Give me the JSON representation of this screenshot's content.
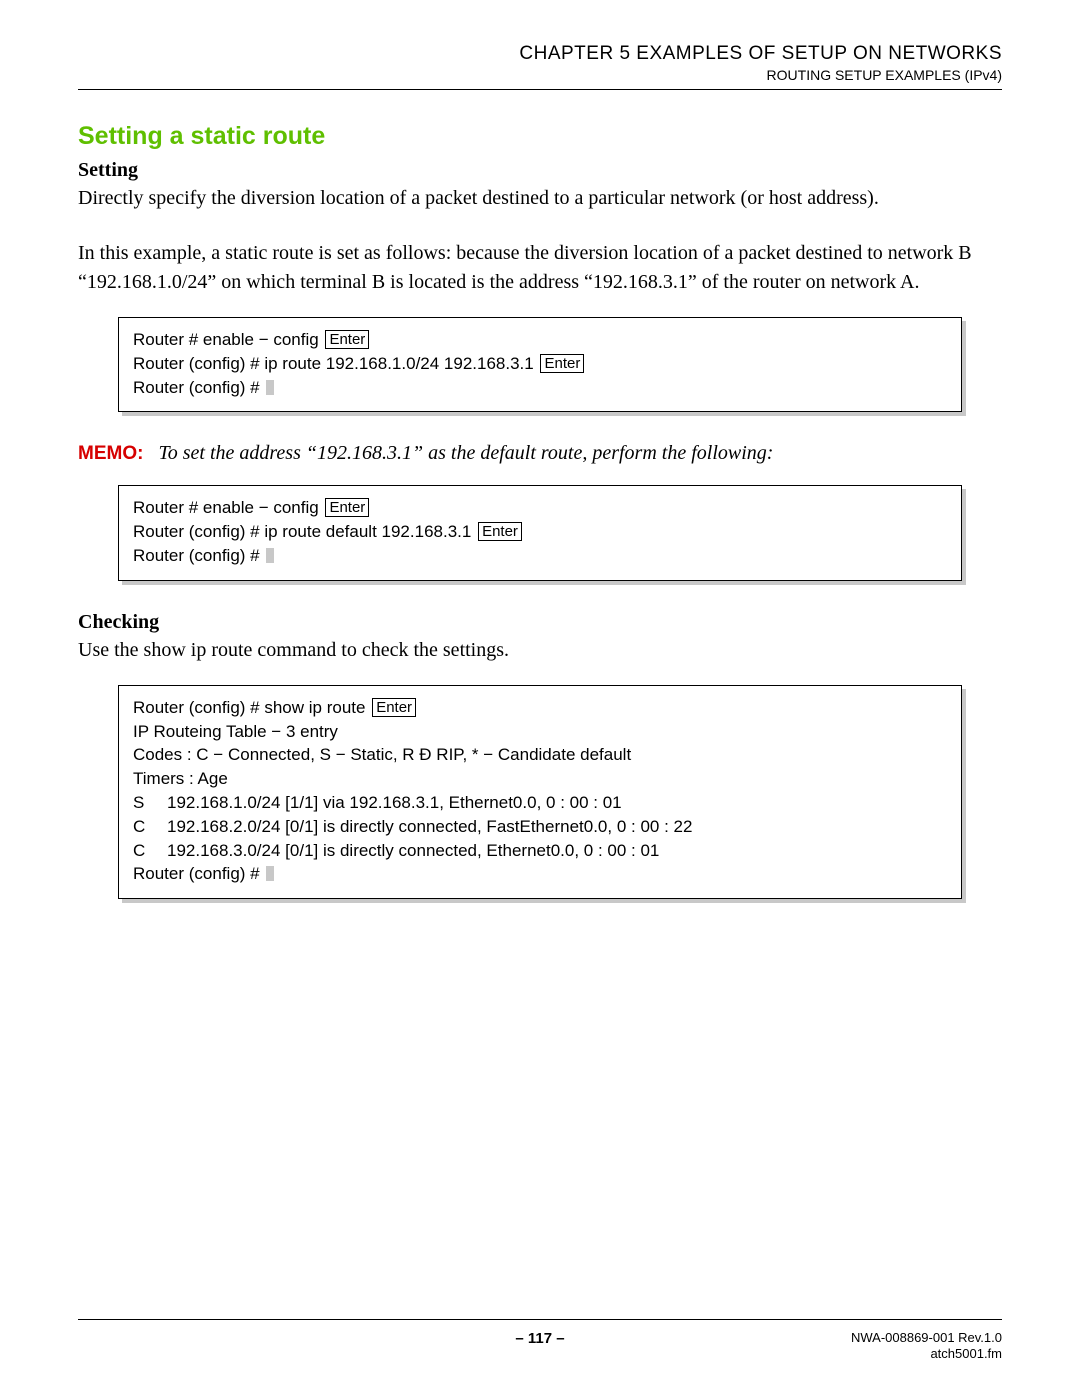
{
  "header": {
    "chapter": "CHAPTER 5   EXAMPLES OF SETUP ON NETWORKS",
    "subtitle": "ROUTING SETUP EXAMPLES (IPv4)"
  },
  "section_title": "Setting a static route",
  "setting": {
    "heading": "Setting",
    "para1": "Directly specify the diversion location of a packet destined to a particular network (or host address).",
    "para2": "In this example, a static route is set as follows: because the diversion location of a packet destined to net­work B “192.168.1.0/24” on which terminal B is located is the address “192.168.3.1” of the router on net­work A."
  },
  "code1": {
    "l1a": "Router # enable − config",
    "l1key": "Enter",
    "l2a": "Router (config) # ip route 192.168.1.0/24 192.168.3.1",
    "l2key": "Enter",
    "l3a": "Router (config) #"
  },
  "memo": {
    "label": "MEMO:",
    "text": "To set the address “192.168.3.1” as the default route, perform the following:"
  },
  "code2": {
    "l1a": "Router # enable − config",
    "l1key": "Enter",
    "l2a": "Router (config) # ip route default 192.168.3.1",
    "l2key": "Enter",
    "l3a": "Router (config) #"
  },
  "checking": {
    "heading": "Checking",
    "para": "Use the show ip route command to check the settings."
  },
  "code3": {
    "l1a": "Router (config) # show ip route",
    "l1key": "Enter",
    "l2": "IP Routeing Table − 3 entry",
    "l3": "Codes : C − Connected, S − Static, R Ð RIP, * − Candidate default",
    "l4": "Timers : Age",
    "r1code": "S",
    "r1": "192.168.1.0/24 [1/1] via 192.168.3.1, Ethernet0.0, 0 : 00 : 01",
    "r2code": "C",
    "r2": "192.168.2.0/24 [0/1] is directly connected, FastEthernet0.0, 0 : 00 : 22",
    "r3code": "C",
    "r3": "192.168.3.0/24 [0/1] is directly connected, Ethernet0.0, 0 : 00 : 01",
    "l8": "Router (config) #"
  },
  "footer": {
    "page": "– 117 –",
    "doc": "NWA-008869-001 Rev.1.0",
    "file": "atch5001.fm"
  }
}
